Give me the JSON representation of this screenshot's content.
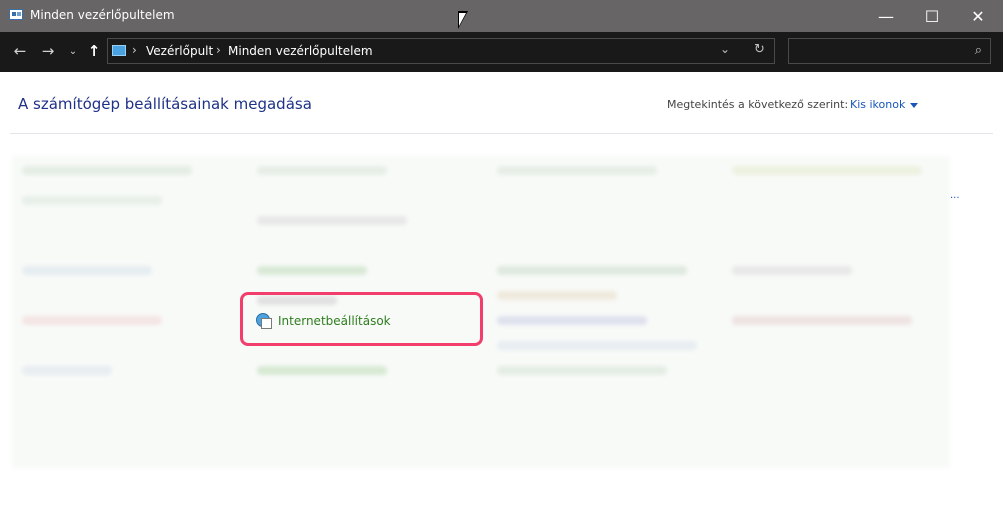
{
  "window": {
    "title": "Minden vezérlőpultelem",
    "app_icon": "control-panel-icon",
    "controls": {
      "minimize": "—",
      "maximize": "☐",
      "close": "✕"
    }
  },
  "nav": {
    "back": "←",
    "forward": "→",
    "recent": "⌄",
    "up": "↑",
    "breadcrumbs": [
      "Vezérlőpult",
      "Minden vezérlőpultelem"
    ],
    "separator": "›",
    "dropdown": "⌄",
    "refresh": "↻"
  },
  "search": {
    "placeholder": "",
    "icon": "⌕"
  },
  "main": {
    "heading": "A számítógép beállításainak megadása",
    "view_by_label": "Megtekintés a következő szerint:",
    "view_by_value": "Kis ikonok",
    "more": "..."
  },
  "highlighted_item": {
    "label": "Internetbeállítások",
    "icon": "internet-options-icon",
    "highlight_color": "#f23e6c"
  }
}
